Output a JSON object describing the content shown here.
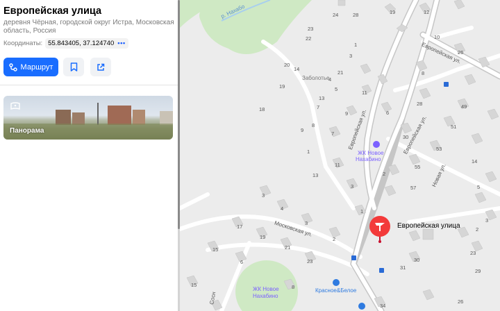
{
  "place": {
    "title": "Европейская улица",
    "address": "деревня Чёрная, городской округ Истра, Московская область, Россия",
    "coords_label": "Координаты:",
    "coords_value": "55.843405, 37.124740",
    "coords_more": "•••"
  },
  "actions": {
    "route_label": "Маршрут",
    "bookmark_icon": "bookmark-icon",
    "share_icon": "share-icon"
  },
  "panorama": {
    "label": "Панорама"
  },
  "map": {
    "marker_label": "Европейская улица",
    "labels": {
      "river": "р. Нахабо",
      "zabolotye": "Заболотье",
      "zhk_1": "ЖК Новое",
      "zhk_2": "Нахабино",
      "zhk_b1": "ЖК Новое",
      "zhk_b2": "Нахабино",
      "krasnoe": "Красное&Белое",
      "street_evropeyskaya_1": "Европейская ул.",
      "street_evropeyskaya_2": "Европейская ул.",
      "street_evropeyskaya_3": "Европейская ул.",
      "street_moskovskaya": "Московская ул.",
      "street_novaya": "Новая ул.",
      "street_sosn": "Сосн"
    },
    "house_numbers": [
      "24",
      "28",
      "19",
      "12",
      "23",
      "22",
      "10",
      "26",
      "1",
      "20",
      "3",
      "14",
      "21",
      "8",
      "19",
      "4",
      "5",
      "13",
      "11",
      "28",
      "49",
      "18",
      "7",
      "6",
      "9",
      "8",
      "51",
      "9",
      "7",
      "30",
      "53",
      "1",
      "14",
      "11",
      "2",
      "55",
      "13",
      "3",
      "57",
      "3",
      "5",
      "4",
      "1",
      "3",
      "17",
      "19",
      "2",
      "2",
      "3",
      "15",
      "6",
      "21",
      "23",
      "31",
      "30",
      "23",
      "29",
      "15",
      "8",
      "34",
      "26"
    ],
    "colors": {
      "background": "#ececec",
      "road": "#ffffff",
      "main_road": "#c9c9c9",
      "forest": "#cfe9c4",
      "building": "#d6d6d6",
      "marker": "#f33a3a"
    }
  }
}
